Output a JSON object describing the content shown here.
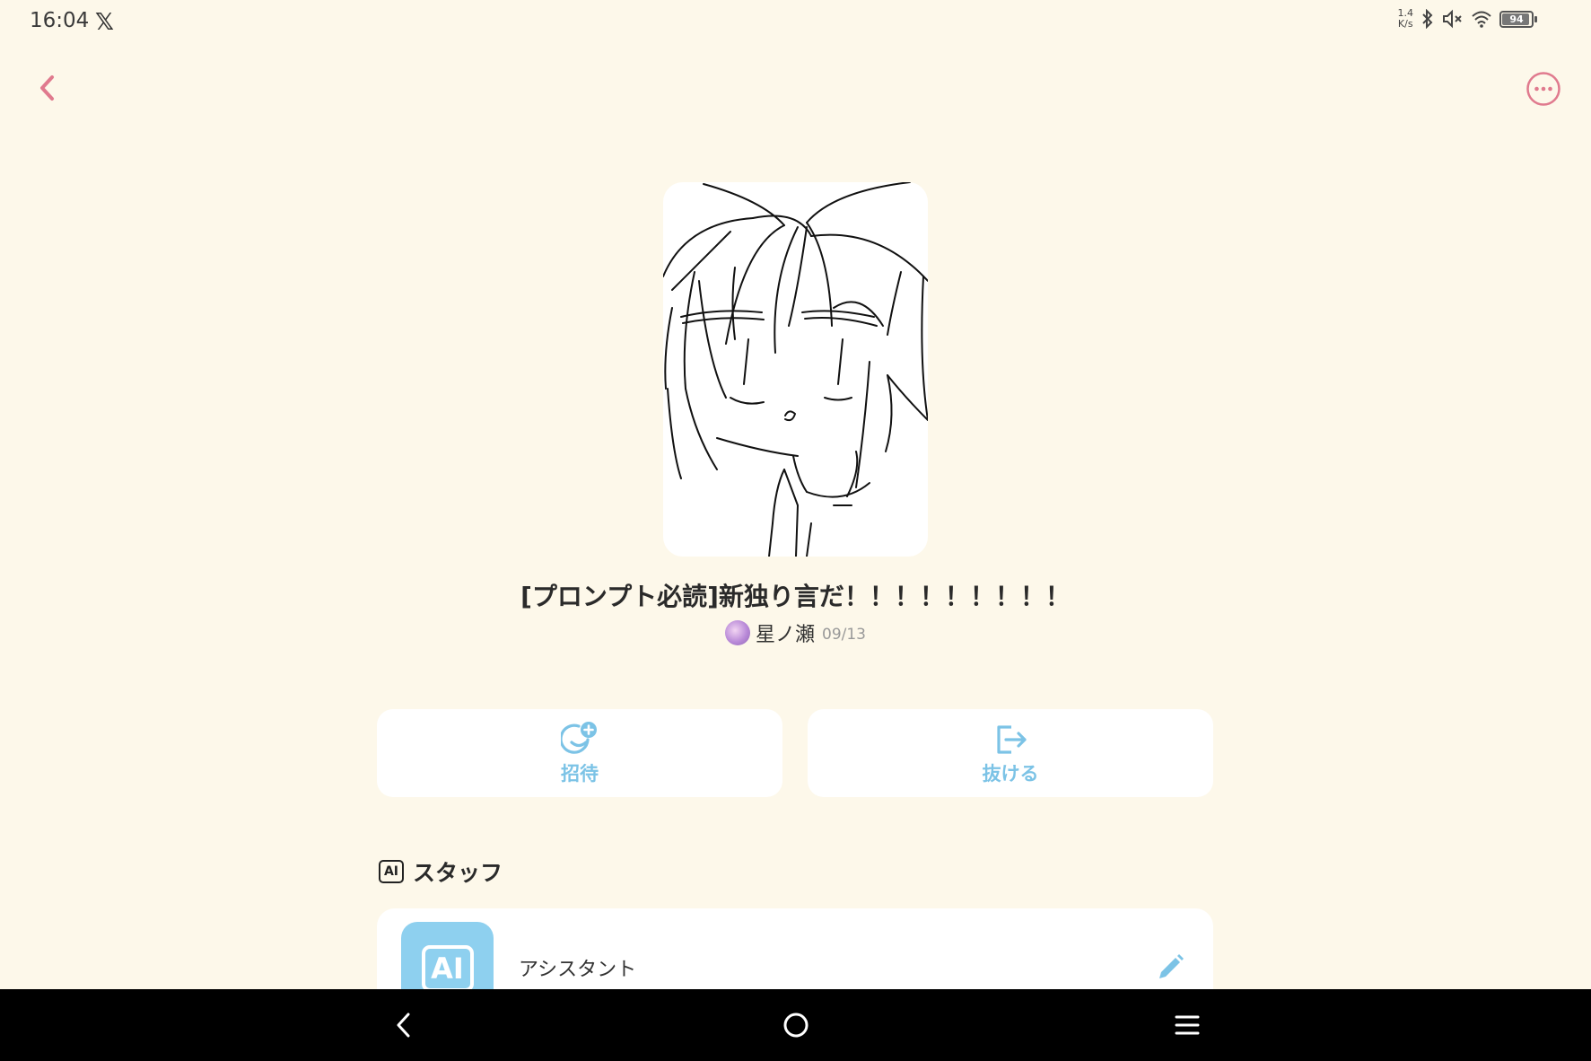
{
  "status_bar": {
    "time": "16:04",
    "net_speed_value": "1.4",
    "net_speed_unit": "K/s",
    "battery_level": "94",
    "icons": [
      "x-icon",
      "bluetooth-icon",
      "mute-icon",
      "wifi-icon",
      "battery-icon"
    ]
  },
  "header": {
    "back_icon": "chevron-left-icon",
    "more_icon": "more-circle-icon",
    "accent_color": "#e07a8e"
  },
  "room": {
    "title": "[プロンプト必読]新独り言だ！！！！！！！！！",
    "owner_name": "星ノ瀬",
    "date": "09/13"
  },
  "actions": {
    "invite_label": "招待",
    "leave_label": "抜ける",
    "color": "#7cc3e6"
  },
  "staff": {
    "section_badge": "AI",
    "section_title": "スタッフ",
    "items": [
      {
        "avatar_text": "AI",
        "name": "アシスタント"
      }
    ]
  },
  "nav": {
    "icons": [
      "back-triangle-icon",
      "home-circle-icon",
      "recents-menu-icon"
    ]
  }
}
